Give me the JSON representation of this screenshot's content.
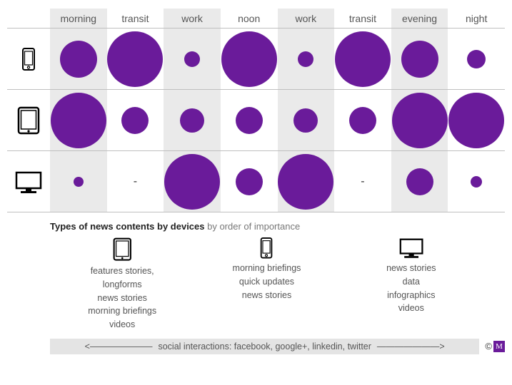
{
  "chart_data": {
    "type": "table",
    "title": "Device news consumption intensity by time of day",
    "categories": [
      "morning",
      "transit",
      "work",
      "noon",
      "work",
      "transit",
      "evening",
      "night"
    ],
    "series": [
      {
        "name": "Smartphone",
        "values": [
          3,
          5,
          1,
          5,
          1,
          5,
          3,
          1
        ]
      },
      {
        "name": "Tablet",
        "values": [
          5,
          2,
          2,
          2,
          2,
          2,
          5,
          5
        ]
      },
      {
        "name": "Desktop",
        "values": [
          0.5,
          null,
          5,
          2,
          5,
          null,
          2,
          0.5
        ]
      }
    ],
    "value_meaning": "bubble relative size (0.5=small dot, 5=full cell, null=not applicable)"
  },
  "columns": {
    "c1": "morning",
    "c2": "transit",
    "c3": "work",
    "c4": "noon",
    "c5": "work",
    "c6": "transit",
    "c7": "evening",
    "c8": "night"
  },
  "dash": "-",
  "section2": {
    "title_bold": "Types of news contents by devices",
    "title_rest": "  by order of importance",
    "tablet": [
      "features stories,",
      "longforms",
      "news stories",
      "morning briefings",
      "videos"
    ],
    "phone": [
      "morning briefings",
      "quick updates",
      "news stories"
    ],
    "desktop": [
      "news stories",
      "data",
      "infographics",
      "videos"
    ]
  },
  "footer": {
    "arrow_left": "<———————",
    "text": "social interactions: facebook, google+, linkedin, twitter",
    "arrow_right": "———————>",
    "copyright_symbol": "©",
    "logo_letter": "M"
  }
}
